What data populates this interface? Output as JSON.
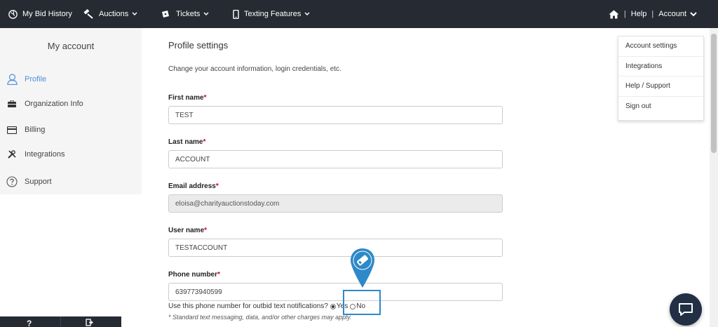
{
  "nav": {
    "bid_history": "My Bid History",
    "auctions": "Auctions",
    "tickets": "Tickets",
    "texting": "Texting Features",
    "help": "Help",
    "account": "Account",
    "separator": "|"
  },
  "sidebar": {
    "title": "My account",
    "items": [
      {
        "label": "Profile"
      },
      {
        "label": "Organization Info"
      },
      {
        "label": "Billing"
      },
      {
        "label": "Integrations"
      },
      {
        "label": "Support"
      }
    ]
  },
  "main": {
    "title": "Profile settings",
    "description": "Change your account information, login credentials, etc.",
    "first_name": {
      "label": "First name",
      "value": "TEST"
    },
    "last_name": {
      "label": "Last name",
      "value": "ACCOUNT"
    },
    "email": {
      "label": "Email address",
      "value": "eloisa@charityauctionstoday.com"
    },
    "username": {
      "label": "User name",
      "value": "TESTACCOUNT"
    },
    "phone": {
      "label": "Phone number",
      "value": "639773940599"
    },
    "required_mark": "*",
    "notif_question": "Use this phone number for outbid text notifications?",
    "yes_label": "Yes",
    "no_label": "No",
    "disclaimer": "* Standard text messaging, data, and/or other charges may apply."
  },
  "dropdown": {
    "items": [
      "Account settings",
      "Integrations",
      "Help / Support",
      "Sign out"
    ]
  },
  "bottombar": {
    "help_glyph": "?"
  },
  "colors": {
    "nav_bg": "#252a33",
    "accent": "#4a90d9",
    "required": "#d0021b",
    "highlight": "#2e89c8",
    "chat_bg": "#232f45"
  }
}
